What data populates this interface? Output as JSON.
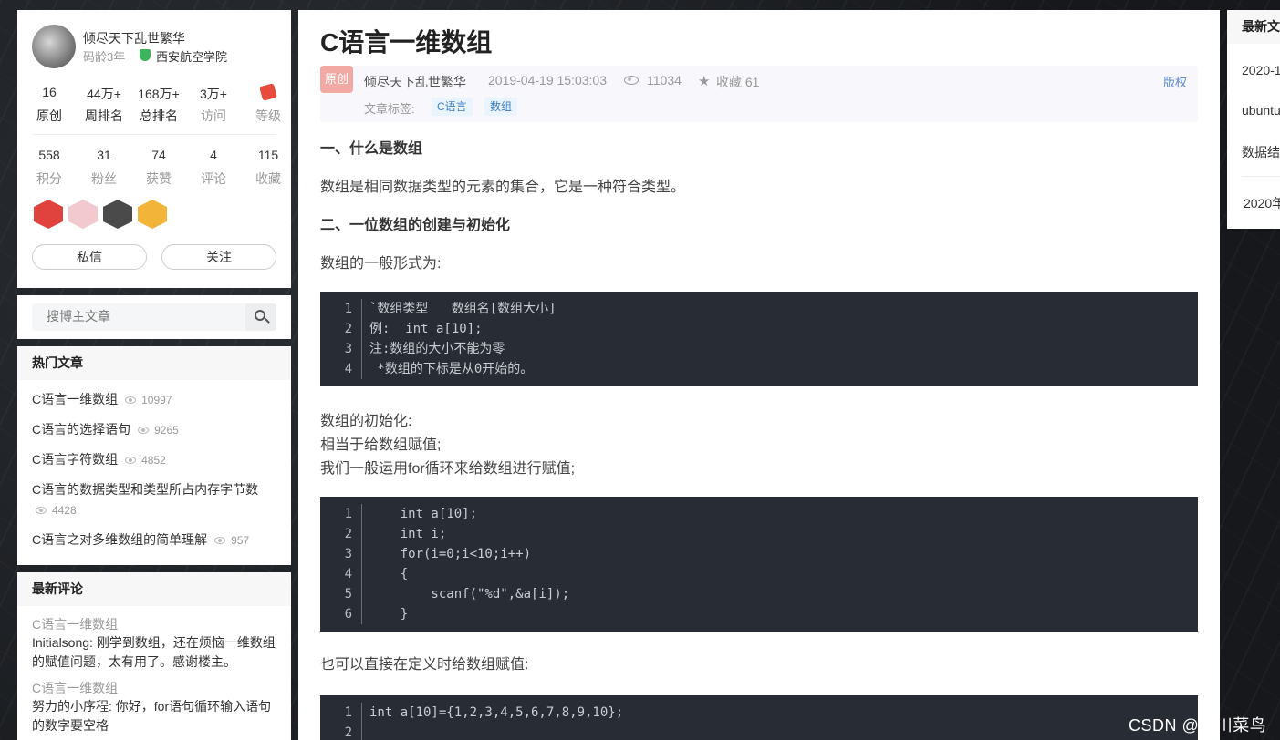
{
  "profile": {
    "name": "倾尽天下乱世繁华",
    "code_age": "码龄3年",
    "school": "西安航空学院",
    "stats_row1": [
      {
        "num": "16",
        "label": "原创"
      },
      {
        "num": "44万+",
        "label": "周排名"
      },
      {
        "num": "168万+",
        "label": "总排名"
      },
      {
        "num": "3万+",
        "label": "访问"
      },
      {
        "num": "",
        "label": "等级"
      }
    ],
    "stats_row2": [
      {
        "num": "558",
        "label": "积分"
      },
      {
        "num": "31",
        "label": "粉丝"
      },
      {
        "num": "74",
        "label": "获赞"
      },
      {
        "num": "4",
        "label": "评论"
      },
      {
        "num": "115",
        "label": "收藏"
      }
    ],
    "message_btn": "私信",
    "follow_btn": "关注"
  },
  "search": {
    "placeholder": "搜博主文章"
  },
  "hot": {
    "title": "热门文章",
    "items": [
      {
        "title": "C语言一维数组",
        "views": "10997"
      },
      {
        "title": "C语言的选择语句",
        "views": "9265"
      },
      {
        "title": "C语言字符数组",
        "views": "4852"
      },
      {
        "title": "C语言的数据类型和类型所占内存字节数",
        "views": "4428"
      },
      {
        "title": "C语言之对多维数组的简单理解",
        "views": "957"
      }
    ]
  },
  "comments": {
    "title": "最新评论",
    "items": [
      {
        "article": "C语言一维数组",
        "text": "Initialsong: 刚学到数组，还在烦恼一维数组的赋值问题，太有用了。感谢楼主。"
      },
      {
        "article": "C语言一维数组",
        "text": "努力的小序程: 你好，for语句循环输入语句的数字要空格"
      }
    ]
  },
  "article": {
    "title": "C语言一维数组",
    "original_tag": "原创",
    "author": "倾尽天下乱世繁华",
    "date": "2019-04-19 15:03:03",
    "views": "11034",
    "favorites": "收藏 61",
    "copyright": "版权",
    "tags_label": "文章标签:",
    "tags": [
      "C语言",
      "数组"
    ],
    "h1": "一、什么是数组",
    "p1": "数组是相同数据类型的元素的集合，它是一种符合类型。",
    "h2": "二、一位数组的创建与初始化",
    "p2": "数组的一般形式为:",
    "code1": [
      "`数组类型   数组名[数组大小]",
      "例:  int a[10];",
      "注:数组的大小不能为零",
      " *数组的下标是从0开始的。"
    ],
    "p3a": "数组的初始化:",
    "p3b": "相当于给数组赋值;",
    "p3c": "我们一般运用for循环来给数组进行赋值;",
    "code2": [
      "    int a[10];",
      "    int i;",
      "    for(i=0;i<10;i++)",
      "    {",
      "        scanf(\"%d\",&a[i]);",
      "    }"
    ],
    "p4": "也可以直接在定义时给数组赋值:",
    "code3": [
      "int a[10]={1,2,3,4,5,6,7,8,9,10};",
      ""
    ]
  },
  "right": {
    "title": "最新文",
    "items": [
      "2020-1",
      "ubuntu",
      "数据结",
      "2020年"
    ]
  },
  "watermark": "CSDN @川川菜鸟"
}
